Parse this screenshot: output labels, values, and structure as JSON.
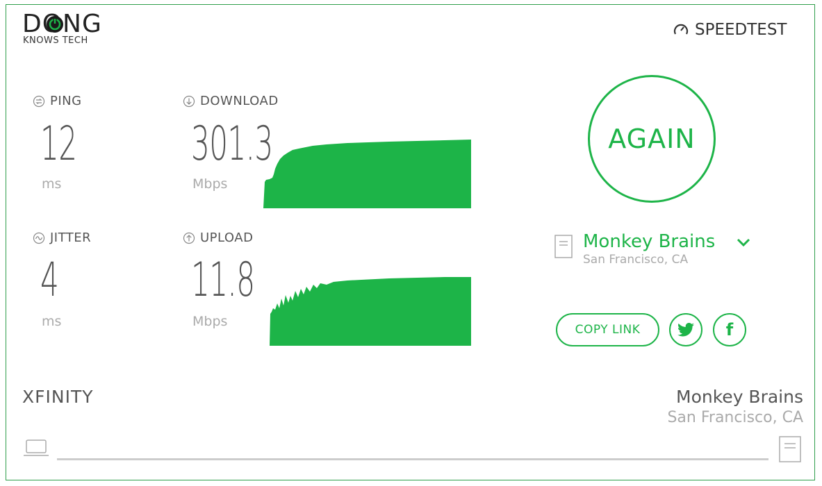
{
  "logo": {
    "main": "DONG",
    "sub": "KNOWS TECH"
  },
  "brand": {
    "name": "SPEEDTEST",
    "icon": "speedometer-icon"
  },
  "metrics": {
    "ping": {
      "label": "PING",
      "value": "12",
      "unit": "ms",
      "icon": "ping-icon"
    },
    "jitter": {
      "label": "JITTER",
      "value": "4",
      "unit": "ms",
      "icon": "jitter-icon"
    },
    "download": {
      "label": "DOWNLOAD",
      "value": "301.3",
      "unit": "Mbps",
      "icon": "download-arrow-icon"
    },
    "upload": {
      "label": "UPLOAD",
      "value": "11.8",
      "unit": "Mbps",
      "icon": "upload-arrow-icon"
    }
  },
  "actions": {
    "again": "AGAIN",
    "copy_link": "COPY LINK",
    "twitter": "twitter-icon",
    "facebook": "f"
  },
  "server": {
    "name": "Monkey Brains",
    "location": "San Francisco, CA"
  },
  "footer": {
    "isp": "XFINITY",
    "isp_ip": "",
    "host_name": "Monkey Brains",
    "host_location": "San Francisco, CA"
  },
  "colors": {
    "accent": "#1db448",
    "border": "#2e9e4a",
    "text": "#555555",
    "muted": "#aaaaaa"
  }
}
